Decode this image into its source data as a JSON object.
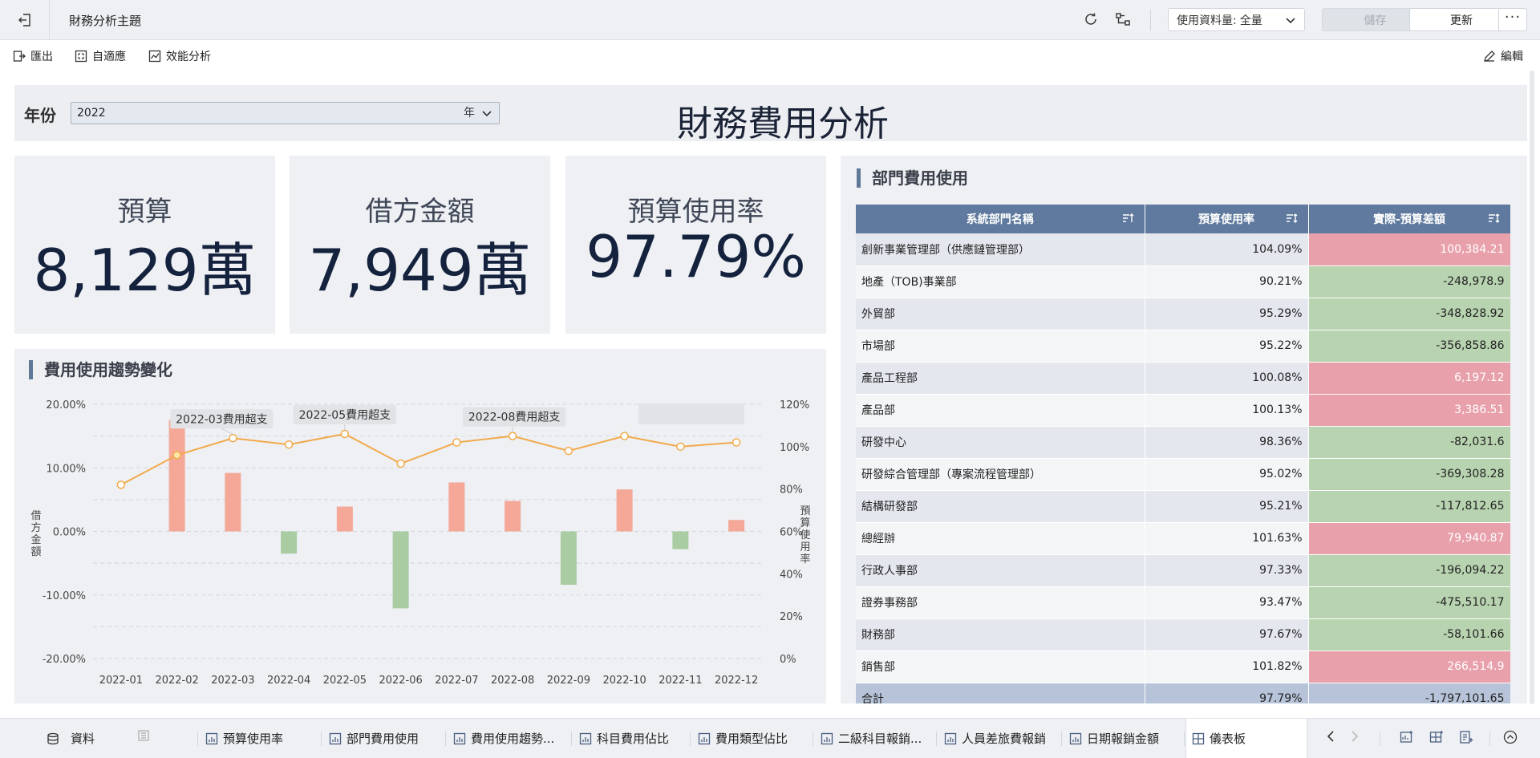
{
  "topbar": {
    "title": "財務分析主題",
    "data_volume_label": "使用資料量:",
    "data_volume_value": "全量",
    "save_label": "儲存",
    "update_label": "更新",
    "more_label": "···",
    "icons": [
      "exit-icon",
      "refresh-icon",
      "lineage-icon",
      "chevron-down-icon"
    ]
  },
  "toolbar": {
    "export_label": "匯出",
    "adaptive_label": "自適應",
    "performance_label": "效能分析",
    "edit_label": "編輯"
  },
  "filter": {
    "label": "年份",
    "value": "2022",
    "unit": "年"
  },
  "dashboard_title": "財務費用分析",
  "kpis": [
    {
      "label": "預算",
      "value": "8,129萬"
    },
    {
      "label": "借方金額",
      "value": "7,949萬"
    },
    {
      "label": "預算使用率",
      "value": "97.79%"
    }
  ],
  "trend_panel": {
    "title": "費用使用趨勢變化"
  },
  "dept_panel": {
    "title": "部門費用使用"
  },
  "chart_data": {
    "type": "bar",
    "categories": [
      "2022-01",
      "2022-02",
      "2022-03",
      "2022-04",
      "2022-05",
      "2022-06",
      "2022-07",
      "2022-08",
      "2022-09",
      "2022-10",
      "2022-11",
      "2022-12"
    ],
    "series": [
      {
        "name": "借方金額",
        "type": "bar",
        "axis": "left",
        "values": [
          0,
          17.5,
          9.2,
          -3.5,
          3.9,
          -12.1,
          7.7,
          4.8,
          -8.4,
          6.6,
          -2.8,
          1.8
        ]
      },
      {
        "name": "預算使用率",
        "type": "line",
        "axis": "right",
        "values": [
          82,
          96,
          104,
          101,
          106,
          92,
          102,
          105,
          98,
          105,
          100,
          102
        ]
      }
    ],
    "ylabel": "借方金額",
    "y2label": "預算使用率",
    "ylim": [
      -20,
      20
    ],
    "y2lim": [
      0,
      120
    ],
    "yticks": [
      "20.00%",
      "10.00%",
      "0.00%",
      "-10.00%",
      "-20.00%"
    ],
    "y2ticks": [
      "120%",
      "100%",
      "80%",
      "60%",
      "40%",
      "20%",
      "0%"
    ],
    "colors": {
      "positive": "#f5a898",
      "negative": "#a9cca3",
      "line": "#f2a94a"
    },
    "annotations": [
      "2022-03費用超支",
      "2022-05費用超支",
      "2022-08費用超支"
    ],
    "grid": true
  },
  "dept_table": {
    "headers": [
      "系統部門名稱",
      "預算使用率",
      "實際-預算差額"
    ],
    "rows": [
      {
        "name": "創新事業管理部（供應鏈管理部）",
        "rate": "104.09%",
        "diff": "100,384.21"
      },
      {
        "name": "地產（TOB)事業部",
        "rate": "90.21%",
        "diff": "-248,978.9"
      },
      {
        "name": "外貿部",
        "rate": "95.29%",
        "diff": "-348,828.92"
      },
      {
        "name": "市場部",
        "rate": "95.22%",
        "diff": "-356,858.86"
      },
      {
        "name": "產品工程部",
        "rate": "100.08%",
        "diff": "6,197.12"
      },
      {
        "name": "產品部",
        "rate": "100.13%",
        "diff": "3,386.51"
      },
      {
        "name": "研發中心",
        "rate": "98.36%",
        "diff": "-82,031.6"
      },
      {
        "name": "研發綜合管理部（專案流程管理部）",
        "rate": "95.02%",
        "diff": "-369,308.28"
      },
      {
        "name": "結構研發部",
        "rate": "95.21%",
        "diff": "-117,812.65"
      },
      {
        "name": "總經辦",
        "rate": "101.63%",
        "diff": "79,940.87"
      },
      {
        "name": "行政人事部",
        "rate": "97.33%",
        "diff": "-196,094.22"
      },
      {
        "name": "證券事務部",
        "rate": "93.47%",
        "diff": "-475,510.17"
      },
      {
        "name": "財務部",
        "rate": "97.67%",
        "diff": "-58,101.66"
      },
      {
        "name": "銷售部",
        "rate": "101.82%",
        "diff": "266,514.9"
      }
    ],
    "total": {
      "name": "合計",
      "rate": "97.79%",
      "diff": "-1,797,101.65"
    }
  },
  "bottom_tabs": {
    "data_label": "資料",
    "tabs": [
      "預算使用率",
      "部門費用使用",
      "費用使用趨勢...",
      "科目費用佔比",
      "費用類型佔比",
      "二級科目報銷...",
      "人員差旅費報銷",
      "日期報銷金額",
      "儀表板"
    ]
  }
}
